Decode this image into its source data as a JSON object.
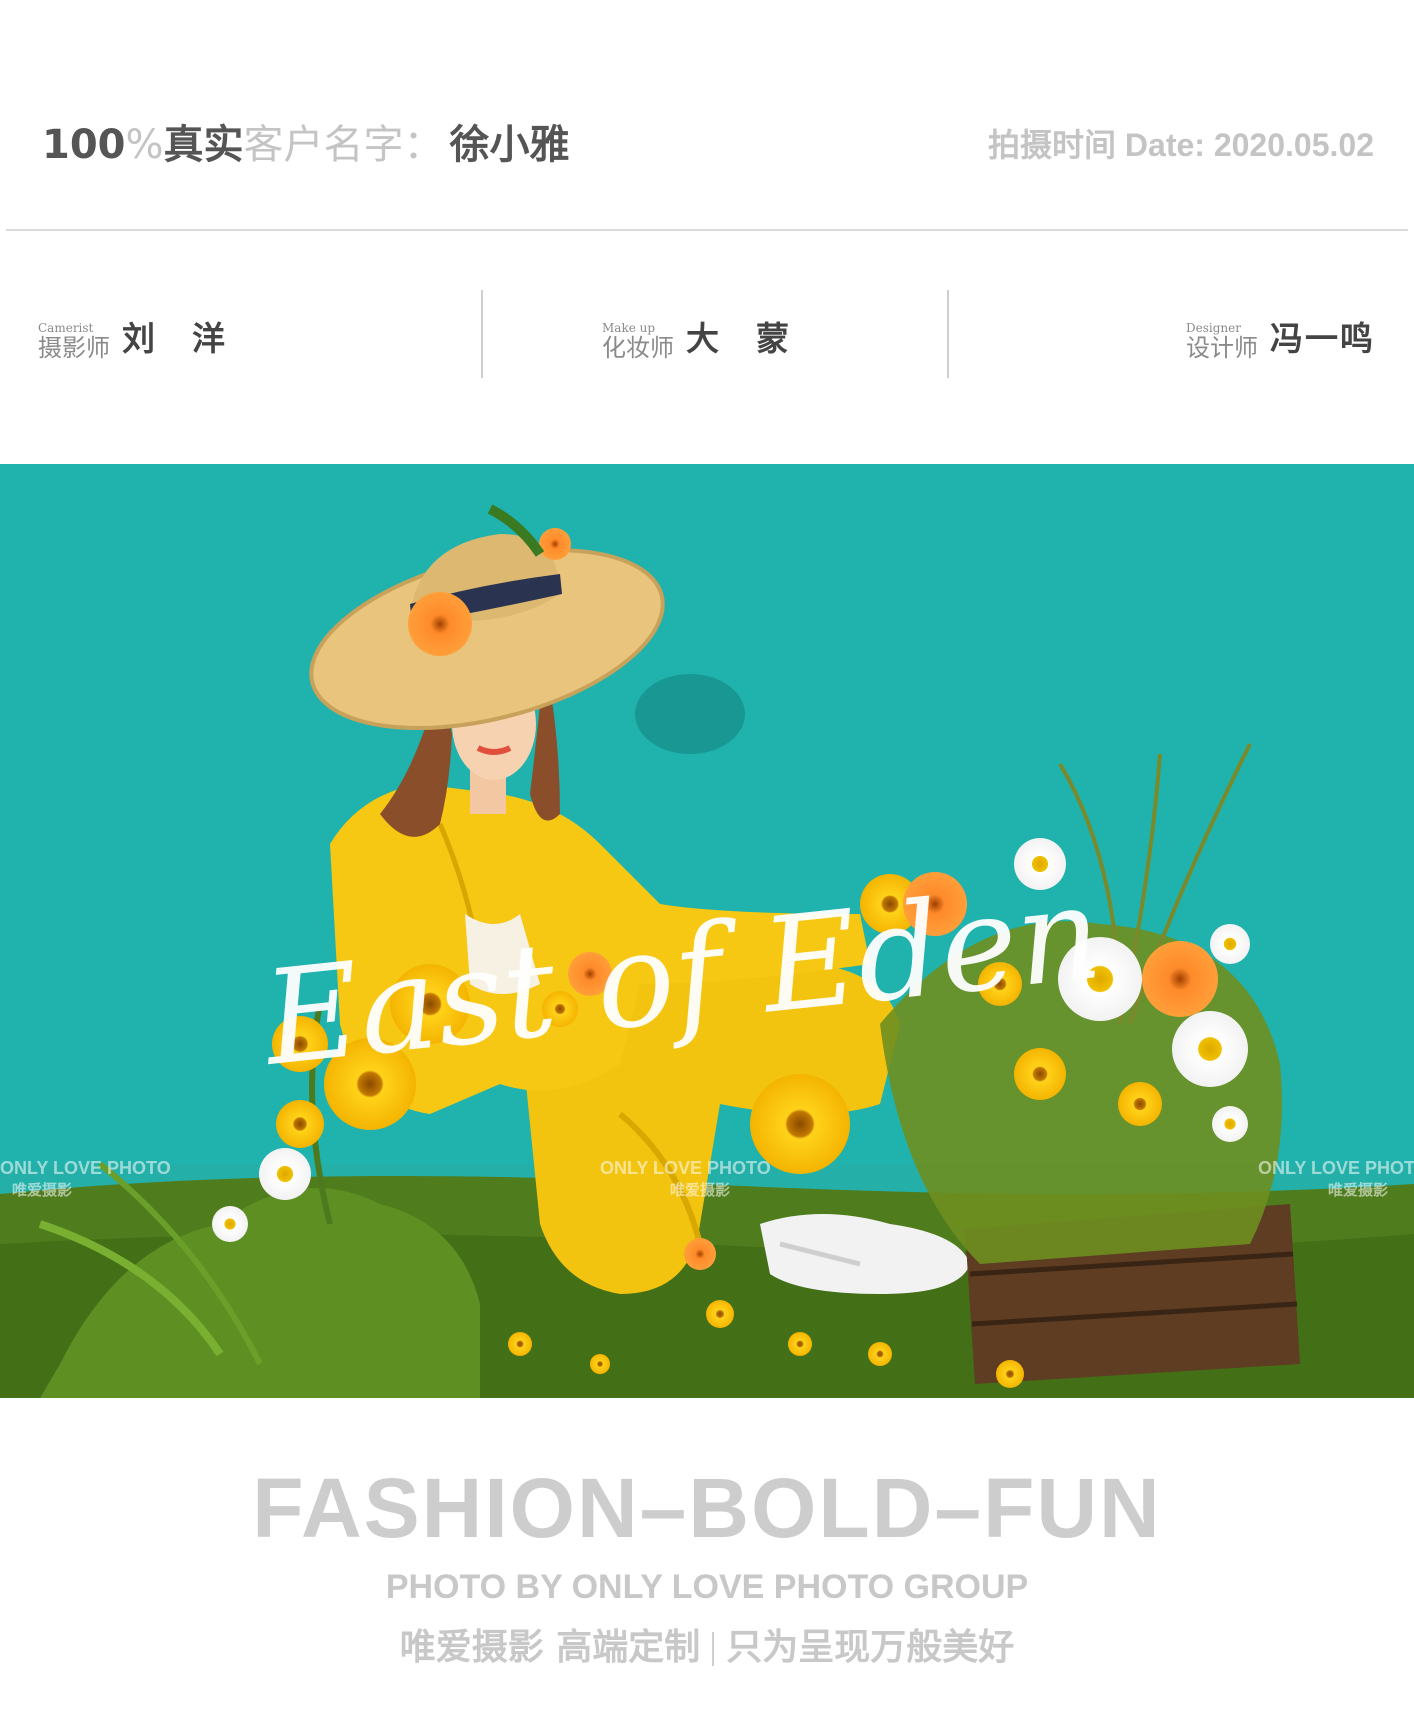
{
  "header": {
    "percent_num": "100",
    "percent_sign": "%",
    "real": "真实",
    "client_label": "客户名字：",
    "client_name": "徐小雅",
    "shoot_date": "拍摄时间 Date: 2020.05.02"
  },
  "credits": [
    {
      "role_en": "Camerist",
      "role_cn": "摄影师",
      "name": "刘　洋"
    },
    {
      "role_en": "Make up",
      "role_cn": "化妆师",
      "name": "大　蒙"
    },
    {
      "role_en": "Designer",
      "role_cn": "设计师",
      "name": "冯一鸣"
    }
  ],
  "photo": {
    "script_title": "East of Eden",
    "watermark_en": "ONLY LOVE PHOTO",
    "watermark_cn": "唯爱摄影",
    "colors": {
      "backdrop": "#20b2ad",
      "grass": "#4a7a1a",
      "suit": "#f2c410",
      "hat": "#e8c77e"
    }
  },
  "footer": {
    "slogan": "FASHION–BOLD–FUN",
    "byline": "PHOTO BY ONLY LOVE  PHOTO GROUP",
    "tagline_left": "唯爱摄影 高端定制",
    "tagline_right": "只为呈现万般美好"
  }
}
